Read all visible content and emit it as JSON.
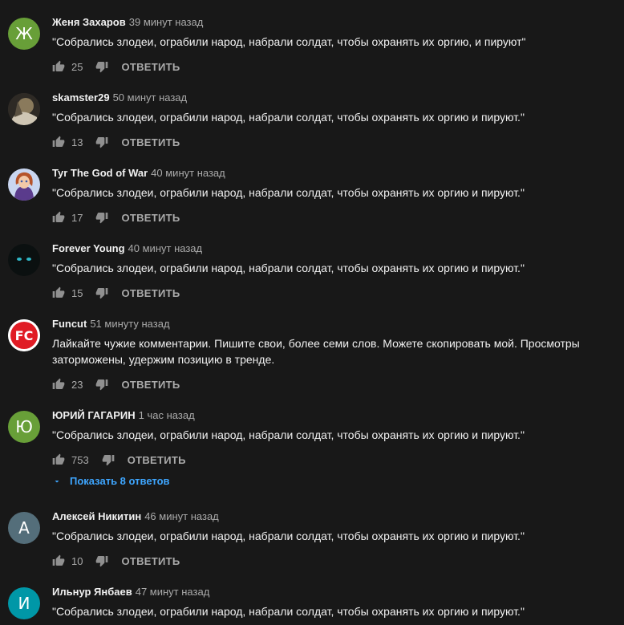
{
  "comments": [
    {
      "author": "Женя Захаров",
      "time": "39 минут назад",
      "text": "\"Собрались злодеи, ограбили народ, набрали солдат, чтобы охранять их оргию, и пируют\"",
      "likes": "25",
      "avatar_letter": "Ж",
      "avatar_color": "#689f38",
      "reply_label": "ОТВЕТИТЬ"
    },
    {
      "author": "skamster29",
      "time": "50 минут назад",
      "text": "\"Собрались злодеи, ограбили народ, набрали солдат, чтобы охранять их оргию и пируют.\"",
      "likes": "13",
      "avatar_letter": "",
      "avatar_color": "#6b6254",
      "reply_label": "ОТВЕТИТЬ"
    },
    {
      "author": "Tyr The God of War",
      "time": "40 минут назад",
      "text": "\"Собрались злодеи, ограбили народ, набрали солдат, чтобы охранять их оргию и пируют.\"",
      "likes": "17",
      "avatar_letter": "",
      "avatar_color": "#5b6fa8",
      "reply_label": "ОТВЕТИТЬ"
    },
    {
      "author": "Forever Young",
      "time": "40 минут назад",
      "text": "\"Собрались злодеи, ограбили народ, набрали солдат, чтобы охранять их оргию и пируют.\"",
      "likes": "15",
      "avatar_letter": "",
      "avatar_color": "#0e1414",
      "reply_label": "ОТВЕТИТЬ"
    },
    {
      "author": "Funcut",
      "time": "51 минуту назад",
      "text": "Лайкайте чужие комментарии. Пишите свои, более семи слов. Можете скопировать мой. Просмотры заторможены, удержим позицию в тренде.",
      "likes": "23",
      "avatar_letter": "FC",
      "avatar_color": "#ffffff",
      "reply_label": "ОТВЕТИТЬ"
    },
    {
      "author": "ЮРИЙ ГАГАРИН",
      "time": "1 час назад",
      "text": "\"Собрались злодеи, ограбили народ, набрали солдат, чтобы охранять их оргию и пируют.\"",
      "likes": "753",
      "avatar_letter": "Ю",
      "avatar_color": "#689f38",
      "reply_label": "ОТВЕТИТЬ",
      "show_replies": "Показать 8 ответов"
    },
    {
      "author": "Алексей Никитин",
      "time": "46 минут назад",
      "text": "\"Собрались злодеи, ограбили народ, набрали солдат, чтобы охранять их оргию и пируют.\"",
      "likes": "10",
      "avatar_letter": "А",
      "avatar_color": "#546e7a",
      "reply_label": "ОТВЕТИТЬ"
    },
    {
      "author": "Ильнур Янбаев",
      "time": "47 минут назад",
      "text": "\"Собрались злодеи, ограбили народ, набрали солдат, чтобы охранять их оргию и пируют.\"",
      "likes": "",
      "avatar_letter": "И",
      "avatar_color": "#0097a7",
      "reply_label": ""
    }
  ]
}
